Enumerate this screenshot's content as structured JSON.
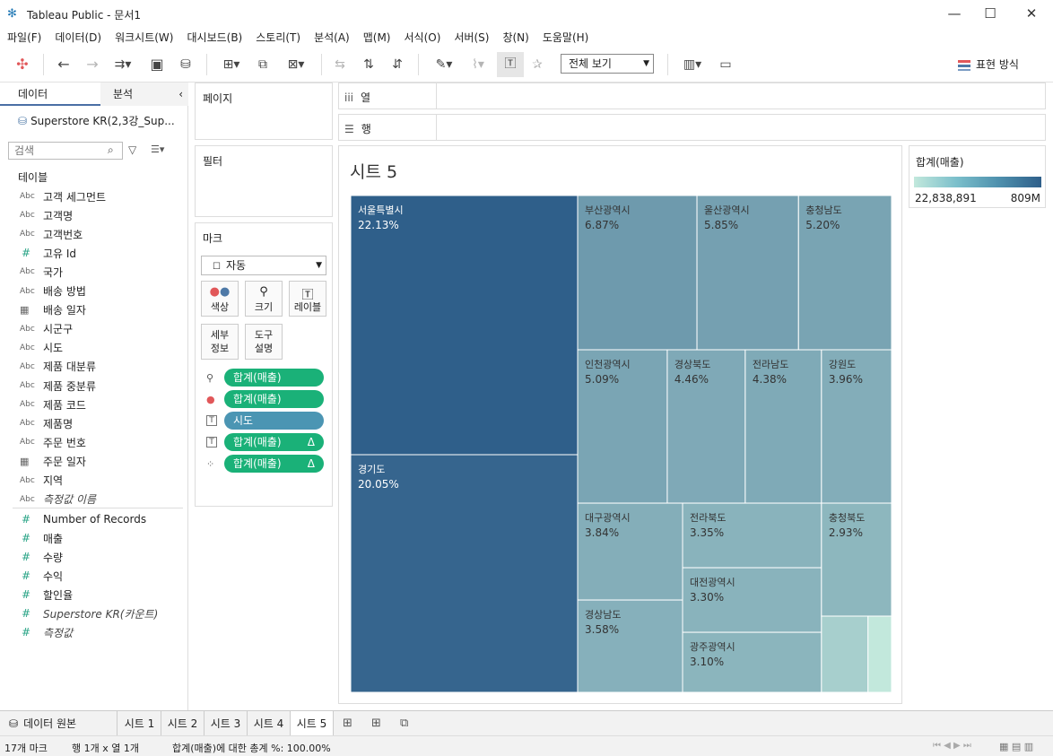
{
  "window": {
    "title": "Tableau Public - 문서1"
  },
  "menu": [
    "파일(F)",
    "데이터(D)",
    "워크시트(W)",
    "대시보드(B)",
    "스토리(T)",
    "분석(A)",
    "맵(M)",
    "서식(O)",
    "서버(S)",
    "창(N)",
    "도움말(H)"
  ],
  "toolbar": {
    "view_select": "전체 보기",
    "show_me": "표현 방식"
  },
  "left_pane": {
    "tab_data": "데이터",
    "tab_analysis": "분석",
    "datasource": "Superstore KR(2,3강_Sup...",
    "search_placeholder": "검색",
    "tables_header": "테이블",
    "dimensions": [
      {
        "type": "Abc",
        "name": "고객 세그먼트"
      },
      {
        "type": "Abc",
        "name": "고객명"
      },
      {
        "type": "Abc",
        "name": "고객번호"
      },
      {
        "type": "#",
        "name": "고유 Id"
      },
      {
        "type": "Abc",
        "name": "국가"
      },
      {
        "type": "Abc",
        "name": "배송 방법"
      },
      {
        "type": "date",
        "name": "배송 일자"
      },
      {
        "type": "Abc",
        "name": "시군구"
      },
      {
        "type": "Abc",
        "name": "시도"
      },
      {
        "type": "Abc",
        "name": "제품 대분류"
      },
      {
        "type": "Abc",
        "name": "제품 중분류"
      },
      {
        "type": "Abc",
        "name": "제품 코드"
      },
      {
        "type": "Abc",
        "name": "제품명"
      },
      {
        "type": "Abc",
        "name": "주문 번호"
      },
      {
        "type": "date",
        "name": "주문 일자"
      },
      {
        "type": "Abc",
        "name": "지역"
      },
      {
        "type": "Abc",
        "name": "측정값 이름",
        "italic": true
      }
    ],
    "measures": [
      {
        "type": "#",
        "name": "Number of Records"
      },
      {
        "type": "#",
        "name": "매출"
      },
      {
        "type": "#",
        "name": "수량"
      },
      {
        "type": "#",
        "name": "수익"
      },
      {
        "type": "#",
        "name": "할인율"
      },
      {
        "type": "#",
        "name": "Superstore KR(카운트)",
        "italic": true
      },
      {
        "type": "#",
        "name": "측정값",
        "italic": true
      }
    ]
  },
  "cards": {
    "pages": "페이지",
    "filters": "필터",
    "marks": "마크",
    "mark_type": "자동",
    "buttons": {
      "color": "색상",
      "size": "크기",
      "label": "레이블",
      "detail_1": "세부",
      "detail_2": "정보",
      "tooltip_1": "도구",
      "tooltip_2": "설명"
    },
    "pills": [
      {
        "icon": "size",
        "label": "합계(매출)",
        "color": "green",
        "delta": false
      },
      {
        "icon": "color",
        "label": "합계(매출)",
        "color": "green",
        "delta": false
      },
      {
        "icon": "label",
        "label": "시도",
        "color": "blue",
        "delta": false
      },
      {
        "icon": "label",
        "label": "합계(매출)",
        "color": "green",
        "delta": true
      },
      {
        "icon": "detail",
        "label": "합계(매출)",
        "color": "green",
        "delta": true
      }
    ],
    "delta_symbol": "Δ"
  },
  "shelves": {
    "columns": "열",
    "rows": "행"
  },
  "sheet": {
    "title": "시트 5"
  },
  "legend": {
    "title": "합계(매출)",
    "min_label": "22,838,891",
    "max_label": "809M"
  },
  "chart_data": {
    "type": "treemap",
    "measure": "합계(매출)",
    "color_range": [
      "#c2e8dc",
      "#2f5f8a"
    ],
    "items": [
      {
        "name": "서울특별시",
        "label": "22.13%",
        "percent": 22.13
      },
      {
        "name": "경기도",
        "label": "20.05%",
        "percent": 20.05
      },
      {
        "name": "부산광역시",
        "label": "6.87%",
        "percent": 6.87
      },
      {
        "name": "울산광역시",
        "label": "5.85%",
        "percent": 5.85
      },
      {
        "name": "충청남도",
        "label": "5.20%",
        "percent": 5.2
      },
      {
        "name": "인천광역시",
        "label": "5.09%",
        "percent": 5.09
      },
      {
        "name": "경상북도",
        "label": "4.46%",
        "percent": 4.46
      },
      {
        "name": "전라남도",
        "label": "4.38%",
        "percent": 4.38
      },
      {
        "name": "강원도",
        "label": "3.96%",
        "percent": 3.96
      },
      {
        "name": "대구광역시",
        "label": "3.84%",
        "percent": 3.84
      },
      {
        "name": "경상남도",
        "label": "3.58%",
        "percent": 3.58
      },
      {
        "name": "전라북도",
        "label": "3.35%",
        "percent": 3.35
      },
      {
        "name": "대전광역시",
        "label": "3.30%",
        "percent": 3.3
      },
      {
        "name": "광주광역시",
        "label": "3.10%",
        "percent": 3.1
      },
      {
        "name": "충청북도",
        "label": "2.93%",
        "percent": 2.93
      },
      {
        "name": "",
        "label": "",
        "percent": 1.2
      },
      {
        "name": "",
        "label": "",
        "percent": 0.7
      }
    ]
  },
  "bottom_tabs": {
    "datasource": "데이터 원본",
    "sheets": [
      "시트 1",
      "시트 2",
      "시트 3",
      "시트 4",
      "시트 5"
    ],
    "active_index": 4
  },
  "status": {
    "marks": "17개 마크",
    "rows_cols": "행 1개 x 열 1개",
    "summary": "합계(매출)에 대한 총계 %: 100.00%"
  }
}
